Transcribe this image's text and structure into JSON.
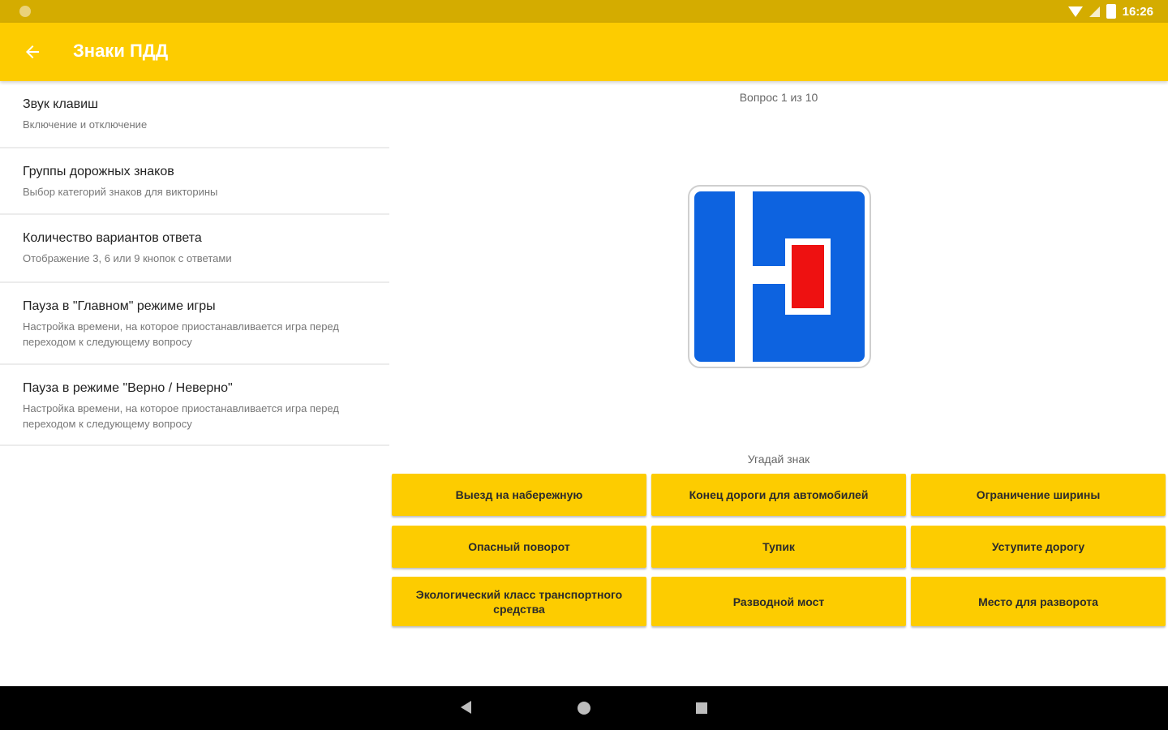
{
  "status_bar": {
    "time": "16:26"
  },
  "app_bar": {
    "title": "Знаки ПДД",
    "back_icon": "arrow-left-icon"
  },
  "settings": [
    {
      "title": "Звук клавиш",
      "description": "Включение и отключение"
    },
    {
      "title": "Группы дорожных знаков",
      "description": "Выбор категорий знаков для викторины"
    },
    {
      "title": "Количество вариантов ответа",
      "description": "Отображение 3, 6 или 9 кнопок с ответами"
    },
    {
      "title": "Пауза в \"Главном\" режиме игры",
      "description": "Настройка времени, на которое приостанавливается игра перед переходом к следующему вопросу"
    },
    {
      "title": "Пауза в режиме \"Верно / Неверно\"",
      "description": "Настройка времени, на которое приостанавливается игра перед переходом к следующему вопросу"
    }
  ],
  "quiz": {
    "counter": "Вопрос 1 из 10",
    "prompt": "Угадай знак",
    "answers": [
      "Выезд на набережную",
      "Конец дороги для автомобилей",
      "Ограничение ширины",
      "Опасный поворот",
      "Тупик",
      "Уступите дорогу",
      "Экологический класс транспортного средства",
      "Разводной мост",
      "Место для разворота"
    ]
  },
  "colors": {
    "accent": "#fdcc00",
    "status": "#d4ac00",
    "sign_blue": "#0d63e0",
    "sign_red": "#ee1111"
  },
  "nav_bar": {
    "icons": [
      "nav-back-icon",
      "nav-home-icon",
      "nav-recents-icon"
    ]
  }
}
